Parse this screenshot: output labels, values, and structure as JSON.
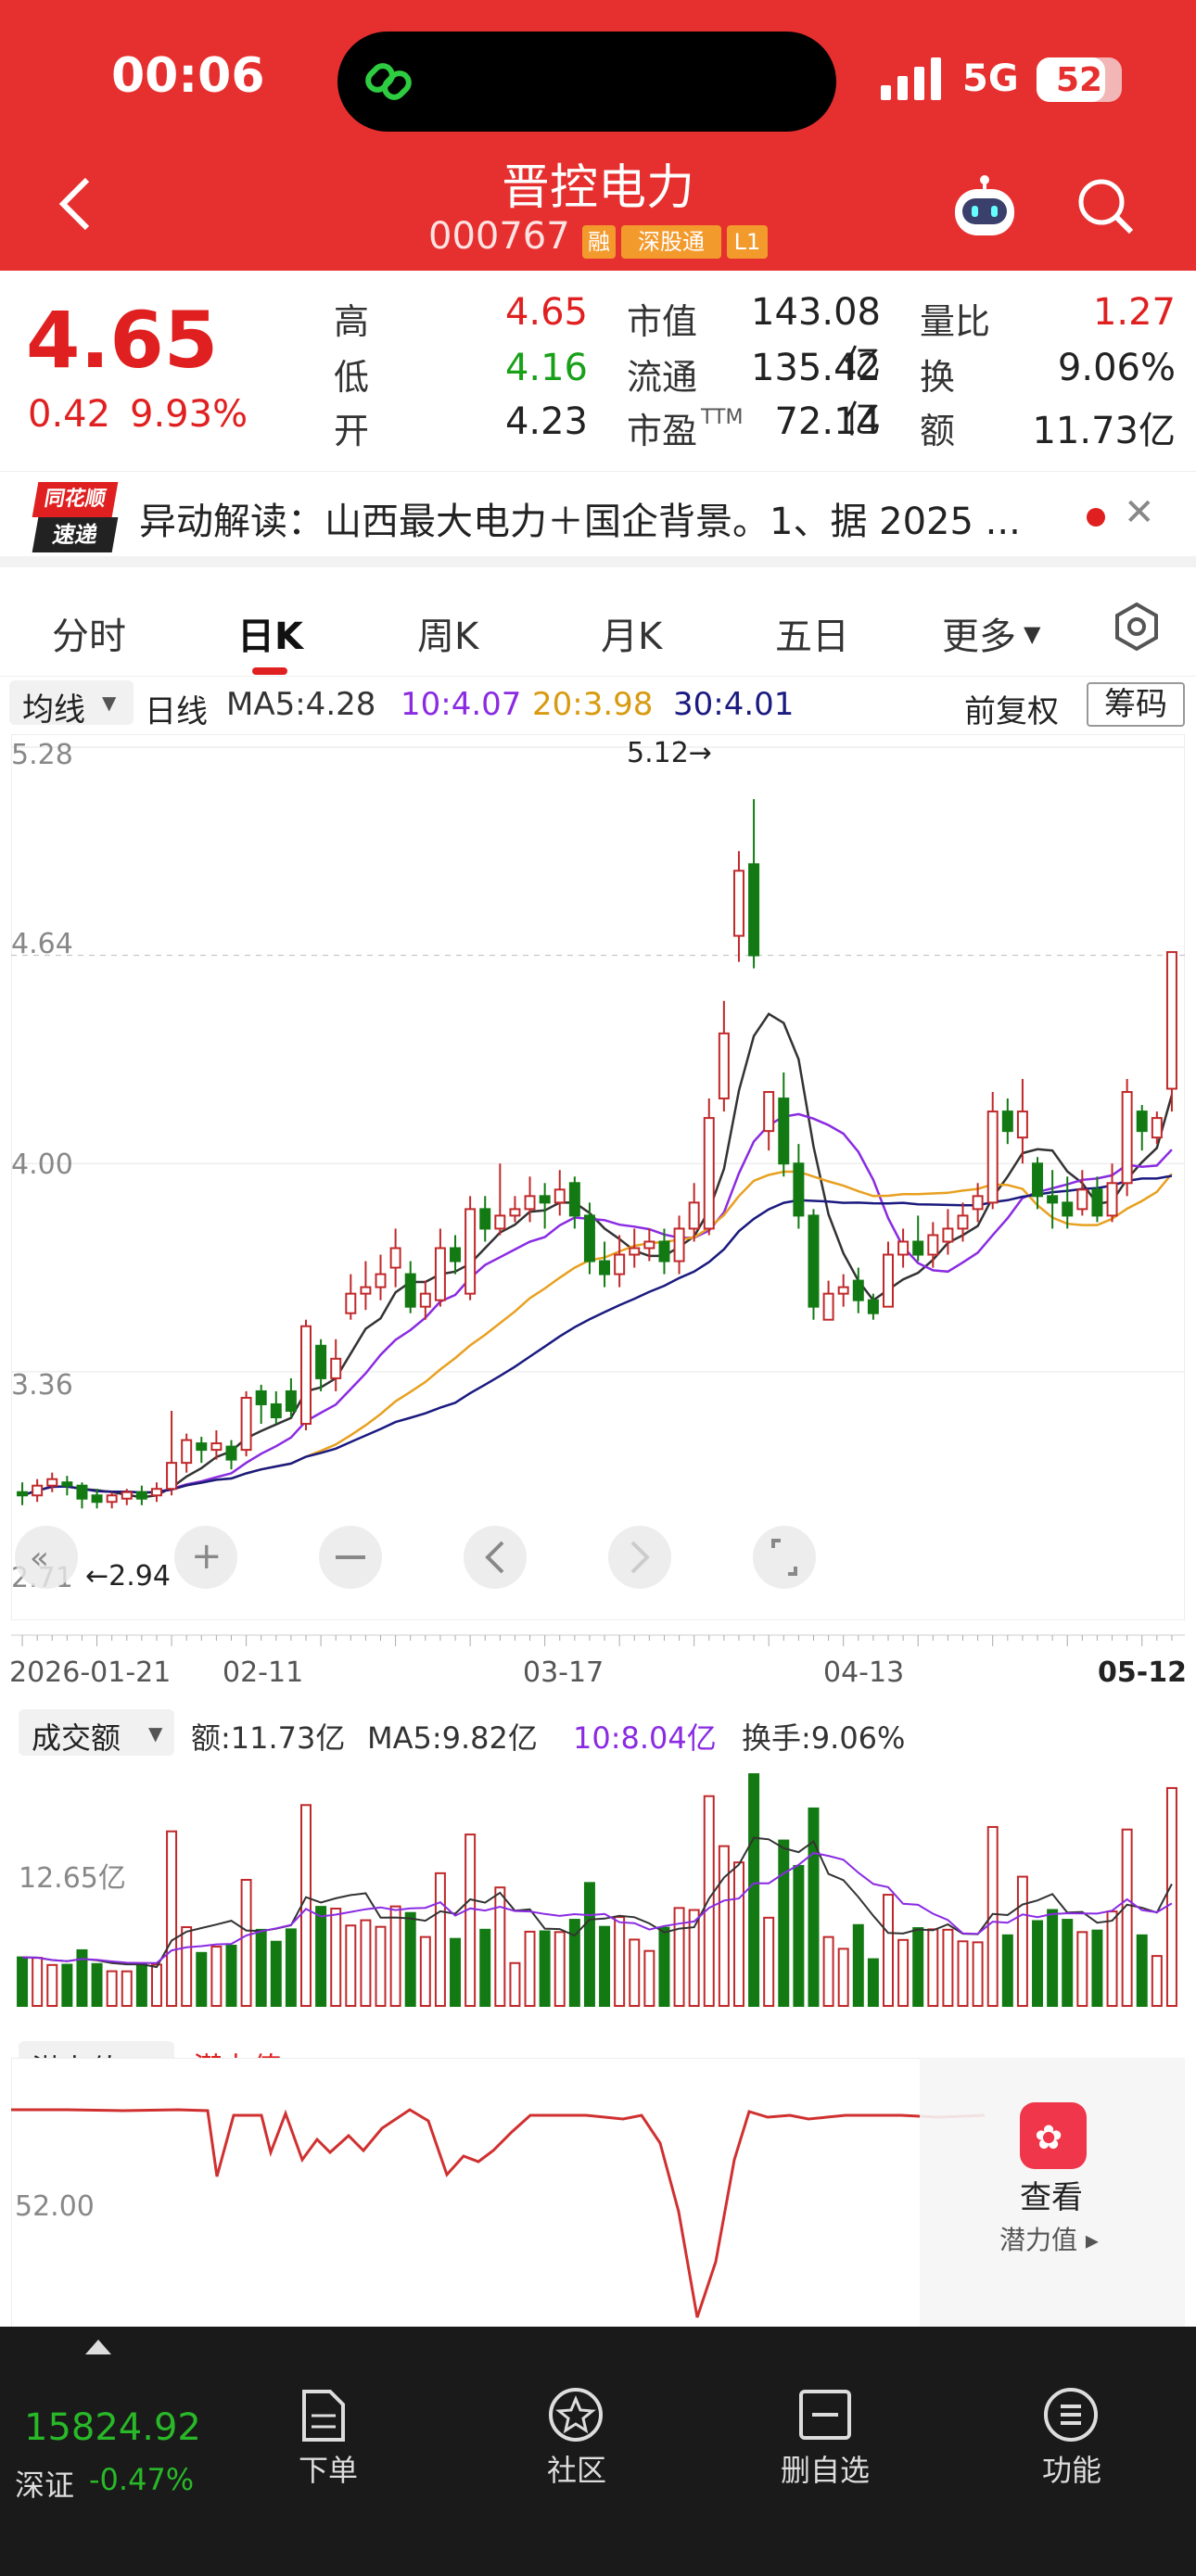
{
  "status_bar": {
    "time": "00:06",
    "network": "5G",
    "battery": "52"
  },
  "header": {
    "title": "晋控电力",
    "code": "000767",
    "tags": [
      "融",
      "深股通",
      "L1"
    ]
  },
  "quote": {
    "price": "4.65",
    "change": "0.42",
    "change_pct": "9.93%",
    "high_label": "高",
    "high": "4.65",
    "low_label": "低",
    "low": "4.16",
    "open_label": "开",
    "open": "4.23",
    "mcap_label": "市值",
    "mcap": "143.08亿",
    "float_label": "流通",
    "float": "135.42亿",
    "pe_label": "市盈",
    "pe_suffix": "TTM",
    "pe": "72.14",
    "vr_label": "量比",
    "vr": "1.27",
    "turn_label": "换",
    "turn": "9.06%",
    "amt_label": "额",
    "amt": "11.73亿"
  },
  "news": {
    "logo_top": "同花顺",
    "logo_bottom": "速递",
    "text": "异动解读：山西最大电力＋国企背景。1、据 2025 ..."
  },
  "tabs": [
    "分时",
    "日K",
    "周K",
    "月K",
    "五日",
    "更多",
    ""
  ],
  "ma_row": {
    "selector": "均线",
    "kind": "日线",
    "ma5": "MA5:4.28",
    "ma10": "10:4.07",
    "ma20": "20:3.98",
    "ma30": "30:4.01",
    "adjust": "前复权",
    "chips": "筹码",
    "colors": {
      "ma5": "#333333",
      "ma10": "#8a2be2",
      "ma20": "#e8a020",
      "ma30": "#1a1a80"
    }
  },
  "kchart": {
    "y_ticks": [
      "5.28",
      "4.64",
      "4.00",
      "3.36",
      "2.71"
    ],
    "high_mark": "5.12→",
    "low_mark": "←2.94"
  },
  "dates": [
    "2026-01-21",
    "02-11",
    "03-17",
    "04-13",
    "05-12"
  ],
  "volume": {
    "selector": "成交额",
    "amt": "额:11.73亿",
    "ma5": "MA5:9.82亿",
    "ma10": "10:8.04亿",
    "turn": "换手:9.06%",
    "tick": "12.65亿"
  },
  "potential": {
    "selector": "潜力值",
    "value": "潜力值:--",
    "tick": "52.00",
    "cta": "查看",
    "cta_sub": "潜力值 ▸"
  },
  "bottom": {
    "index_value": "15824.92",
    "index_name": "深证",
    "index_chg": "-0.47%",
    "buttons": [
      "下单",
      "社区",
      "删自选",
      "功能"
    ]
  },
  "chart_data": {
    "type": "candlestick",
    "ylim": [
      2.71,
      5.28
    ],
    "candles": [
      [
        2.99,
        2.98,
        3.02,
        2.95
      ],
      [
        2.98,
        3.01,
        3.03,
        2.96
      ],
      [
        3.01,
        3.03,
        3.05,
        2.99
      ],
      [
        3.02,
        3.01,
        3.04,
        2.98
      ],
      [
        3.01,
        2.97,
        3.02,
        2.94
      ],
      [
        2.98,
        2.96,
        3.0,
        2.94
      ],
      [
        2.96,
        2.98,
        2.99,
        2.94
      ],
      [
        2.97,
        2.99,
        3.0,
        2.95
      ],
      [
        2.99,
        2.97,
        3.01,
        2.95
      ],
      [
        2.98,
        3.0,
        3.02,
        2.96
      ],
      [
        3.0,
        3.08,
        3.24,
        2.98
      ],
      [
        3.08,
        3.15,
        3.17,
        3.05
      ],
      [
        3.14,
        3.12,
        3.16,
        3.08
      ],
      [
        3.12,
        3.14,
        3.18,
        3.09
      ],
      [
        3.13,
        3.09,
        3.15,
        3.06
      ],
      [
        3.12,
        3.28,
        3.3,
        3.1
      ],
      [
        3.3,
        3.26,
        3.32,
        3.2
      ],
      [
        3.26,
        3.22,
        3.3,
        3.2
      ],
      [
        3.3,
        3.24,
        3.34,
        3.22
      ],
      [
        3.2,
        3.5,
        3.52,
        3.18
      ],
      [
        3.44,
        3.34,
        3.46,
        3.3
      ],
      [
        3.34,
        3.4,
        3.46,
        3.3
      ],
      [
        3.54,
        3.6,
        3.66,
        3.52
      ],
      [
        3.6,
        3.62,
        3.7,
        3.55
      ],
      [
        3.62,
        3.66,
        3.72,
        3.58
      ],
      [
        3.68,
        3.74,
        3.8,
        3.62
      ],
      [
        3.66,
        3.56,
        3.7,
        3.54
      ],
      [
        3.56,
        3.6,
        3.64,
        3.52
      ],
      [
        3.58,
        3.74,
        3.8,
        3.56
      ],
      [
        3.74,
        3.7,
        3.78,
        3.66
      ],
      [
        3.6,
        3.86,
        3.9,
        3.58
      ],
      [
        3.86,
        3.8,
        3.9,
        3.76
      ],
      [
        3.8,
        3.84,
        4.0,
        3.78
      ],
      [
        3.84,
        3.86,
        3.9,
        3.82
      ],
      [
        3.86,
        3.9,
        3.96,
        3.82
      ],
      [
        3.9,
        3.88,
        3.94,
        3.8
      ],
      [
        3.88,
        3.92,
        3.98,
        3.84
      ],
      [
        3.94,
        3.84,
        3.96,
        3.8
      ],
      [
        3.84,
        3.7,
        3.88,
        3.66
      ],
      [
        3.7,
        3.66,
        3.76,
        3.62
      ],
      [
        3.66,
        3.72,
        3.78,
        3.62
      ],
      [
        3.72,
        3.74,
        3.8,
        3.68
      ],
      [
        3.74,
        3.76,
        3.8,
        3.7
      ],
      [
        3.76,
        3.7,
        3.8,
        3.66
      ],
      [
        3.7,
        3.8,
        3.84,
        3.66
      ],
      [
        3.8,
        3.88,
        3.94,
        3.76
      ],
      [
        3.8,
        4.14,
        4.2,
        3.78
      ],
      [
        4.2,
        4.4,
        4.5,
        4.16
      ],
      [
        4.7,
        4.9,
        4.96,
        4.62
      ],
      [
        4.92,
        4.64,
        5.12,
        4.6
      ],
      [
        4.1,
        4.22,
        4.22,
        4.04
      ],
      [
        4.2,
        4.0,
        4.28,
        3.96
      ],
      [
        4.0,
        3.84,
        4.06,
        3.8
      ],
      [
        3.84,
        3.56,
        3.86,
        3.52
      ],
      [
        3.52,
        3.6,
        3.64,
        3.52
      ],
      [
        3.6,
        3.62,
        3.66,
        3.56
      ],
      [
        3.64,
        3.58,
        3.68,
        3.54
      ],
      [
        3.58,
        3.54,
        3.6,
        3.52
      ],
      [
        3.56,
        3.72,
        3.76,
        3.56
      ],
      [
        3.72,
        3.76,
        3.8,
        3.68
      ],
      [
        3.76,
        3.72,
        3.84,
        3.7
      ],
      [
        3.72,
        3.78,
        3.82,
        3.68
      ],
      [
        3.76,
        3.8,
        3.86,
        3.72
      ],
      [
        3.8,
        3.84,
        3.88,
        3.76
      ],
      [
        3.86,
        3.9,
        3.94,
        3.82
      ],
      [
        3.88,
        4.16,
        4.22,
        3.86
      ],
      [
        4.16,
        4.1,
        4.2,
        4.06
      ],
      [
        4.08,
        4.16,
        4.26,
        4.0
      ],
      [
        4.0,
        3.9,
        4.02,
        3.86
      ],
      [
        3.9,
        3.88,
        3.98,
        3.8
      ],
      [
        3.88,
        3.84,
        3.96,
        3.8
      ],
      [
        3.86,
        3.92,
        3.98,
        3.84
      ],
      [
        3.92,
        3.84,
        3.96,
        3.82
      ],
      [
        3.84,
        3.94,
        4.0,
        3.82
      ],
      [
        3.94,
        4.22,
        4.26,
        3.9
      ],
      [
        4.16,
        4.1,
        4.18,
        4.04
      ],
      [
        4.08,
        4.14,
        4.16,
        4.06
      ],
      [
        4.23,
        4.65,
        4.65,
        4.16
      ]
    ]
  }
}
